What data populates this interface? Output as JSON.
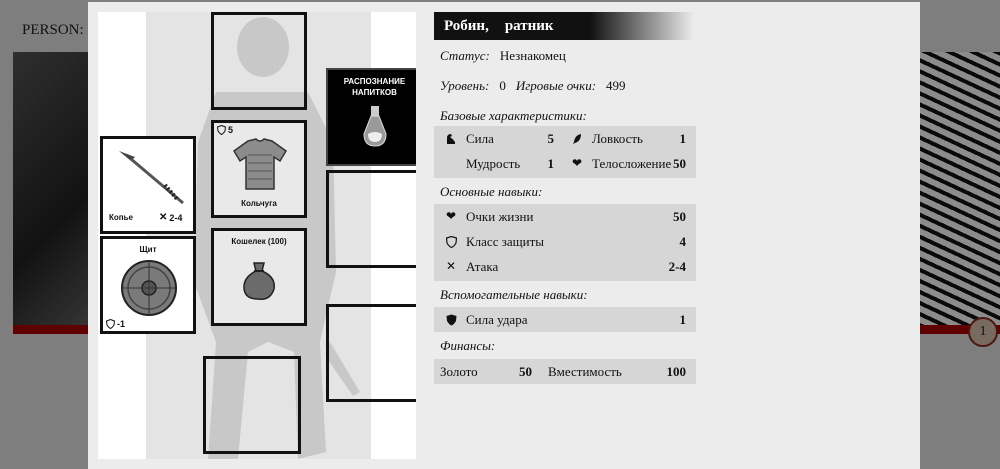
{
  "background": {
    "title": "PERSON:",
    "badge": "1"
  },
  "equipment": {
    "spear": {
      "name": "Копье",
      "stat": "2-4"
    },
    "armor": {
      "name": "Кольчуга",
      "stat": "5"
    },
    "purse": {
      "name": "Кошелек (100)"
    },
    "shield": {
      "name": "Щит",
      "stat": "-1"
    },
    "skill": {
      "line1": "РАСПОЗНАНИЕ",
      "line2": "НАПИТКОВ"
    }
  },
  "character": {
    "name": "Робин,",
    "class": "ратник",
    "status_label": "Статус:",
    "status": "Незнакомец",
    "level_label": "Уровень:",
    "level": "0",
    "points_label": "Игровые очки:",
    "points": "499"
  },
  "base_stats": {
    "title": "Базовые характеристики:",
    "strength_label": "Сила",
    "strength": "5",
    "agility_label": "Ловкость",
    "agility": "1",
    "wisdom_label": "Мудрость",
    "wisdom": "1",
    "constitution_label": "Телосложение",
    "constitution": "50"
  },
  "main_skills": {
    "title": "Основные навыки:",
    "hp_label": "Очки жизни",
    "hp": "50",
    "ac_label": "Класс защиты",
    "ac": "4",
    "attack_label": "Атака",
    "attack": "2-4"
  },
  "aux_skills": {
    "title": "Вспомогательные навыки:",
    "power_label": "Сила удара",
    "power": "1"
  },
  "finance": {
    "title": "Финансы:",
    "gold_label": "Золото",
    "gold": "50",
    "capacity_label": "Вместимость",
    "capacity": "100"
  }
}
